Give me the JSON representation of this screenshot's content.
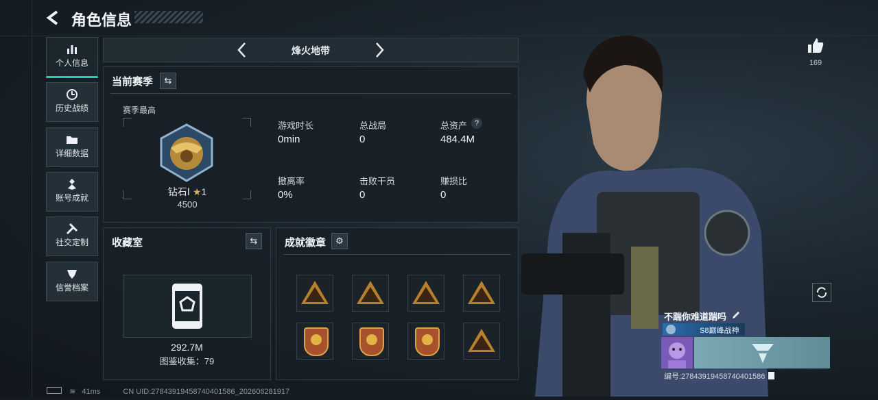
{
  "header": {
    "title": "角色信息"
  },
  "sidebar": {
    "items": [
      {
        "label": "个人信息",
        "icon": "bar-chart-icon"
      },
      {
        "label": "历史战绩",
        "icon": "clock-icon"
      },
      {
        "label": "详细数据",
        "icon": "folder-icon"
      },
      {
        "label": "账号成就",
        "icon": "medal-icon"
      },
      {
        "label": "社交定制",
        "icon": "tools-icon"
      },
      {
        "label": "信誉档案",
        "icon": "shield-icon"
      }
    ]
  },
  "mode_selector": {
    "label": "烽火地带"
  },
  "season": {
    "title": "当前赛季",
    "best_label": "赛季最高",
    "rank_name": "钻石Ⅰ",
    "rank_stars": "1",
    "rank_points": "4500",
    "stats": [
      {
        "label": "游戏时长",
        "value": "0min"
      },
      {
        "label": "总战局",
        "value": "0"
      },
      {
        "label": "总资产",
        "value": "484.4M"
      },
      {
        "label": "撤离率",
        "value": "0%"
      },
      {
        "label": "击败干员",
        "value": "0"
      },
      {
        "label": "赚损比",
        "value": "0"
      }
    ],
    "help": "?"
  },
  "collection": {
    "title": "收藏室",
    "value": "292.7M",
    "count_label": "图鉴收集：79"
  },
  "achievements": {
    "title": "成就徽章"
  },
  "likes": {
    "count": "169"
  },
  "profile": {
    "name": "不踹你难道踹吗",
    "title": "S8巅峰战神",
    "id_label": "编号:27843919458740401586"
  },
  "footer": {
    "ping": "41ms",
    "uid": "CN UID:27843919458740401586_202606281917"
  },
  "colors": {
    "accent": "#1fd3b0",
    "gold": "#d6a64a",
    "panel": "#182027"
  }
}
